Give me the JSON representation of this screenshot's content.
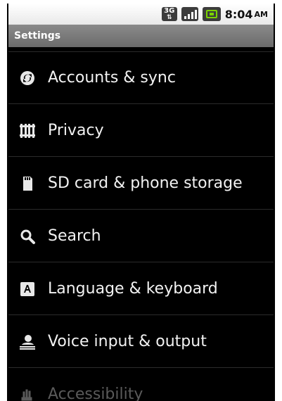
{
  "status_bar": {
    "network_badge": "3G",
    "network_arrows": "⇅",
    "time": "8:04",
    "ampm": "AM",
    "icons": [
      "3g-data-icon",
      "signal-strength-icon",
      "battery-icon"
    ],
    "battery_color": "#7bd300"
  },
  "title_bar": {
    "title": "Settings"
  },
  "settings": {
    "items": [
      {
        "label": "Accounts & sync",
        "icon": "sync-icon"
      },
      {
        "label": "Privacy",
        "icon": "privacy-icon"
      },
      {
        "label": "SD card & phone storage",
        "icon": "sd-card-icon"
      },
      {
        "label": "Search",
        "icon": "search-icon"
      },
      {
        "label": "Language & keyboard",
        "icon": "language-keyboard-icon"
      },
      {
        "label": "Voice input & output",
        "icon": "voice-input-icon"
      },
      {
        "label": "Accessibility",
        "icon": "accessibility-icon"
      }
    ]
  }
}
